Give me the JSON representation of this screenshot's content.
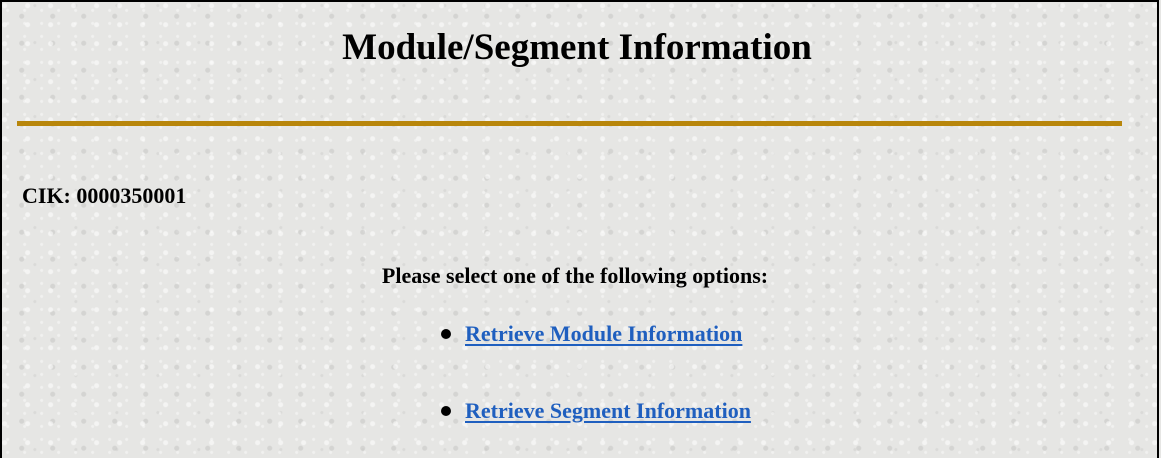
{
  "header": {
    "title": "Module/Segment Information"
  },
  "cik": {
    "label": "CIK:",
    "value": "0000350001"
  },
  "prompt": "Please select one of the following options:",
  "options": [
    {
      "label": "Retrieve Module Information",
      "icon": "bullet-icon"
    },
    {
      "label": "Retrieve Segment Information",
      "icon": "bullet-icon"
    }
  ],
  "colors": {
    "rule": "#b8860b",
    "link": "#1f5fbf",
    "background": "#e6e6e4"
  }
}
